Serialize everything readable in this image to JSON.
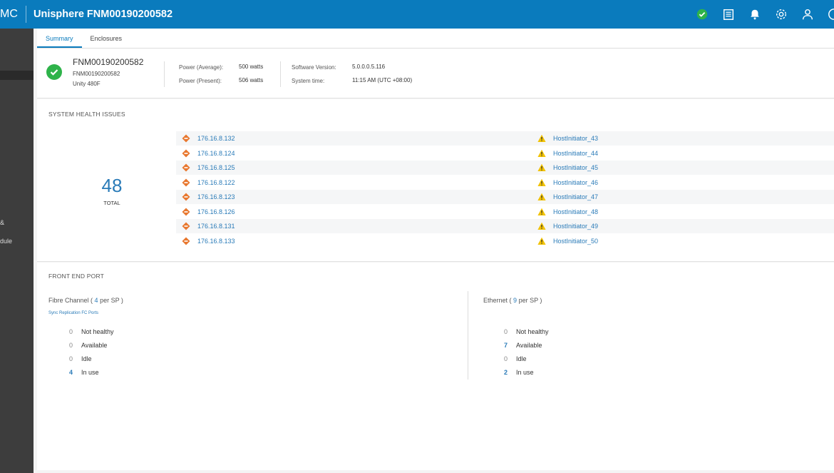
{
  "header": {
    "brand_fragment": "MC",
    "title": "Unisphere FNM00190200582",
    "icons": [
      "status-ok-icon",
      "jobs-icon",
      "alerts-bell-icon",
      "settings-gear-icon",
      "user-icon",
      "help-icon"
    ],
    "accent": "#0a7bbd"
  },
  "sidebar": {
    "fragments": [
      "&",
      "dule"
    ]
  },
  "tabs": [
    {
      "label": "Summary",
      "active": true
    },
    {
      "label": "Enclosures",
      "active": false
    }
  ],
  "system": {
    "name": "FNM00190200582",
    "serial": "FNM00190200582",
    "model": "Unity 480F",
    "power_avg_label": "Power (Average):",
    "power_avg_value": "500 watts",
    "power_present_label": "Power (Present):",
    "power_present_value": "506 watts",
    "software_label": "Software Version:",
    "software_value": "5.0.0.0.5.116",
    "time_label": "System time:",
    "time_value": "11:15 AM (UTC +08:00)"
  },
  "health": {
    "title": "SYSTEM HEALTH ISSUES",
    "total": "48",
    "total_label": "TOTAL",
    "left_issues": [
      "176.16.8.132",
      "176.16.8.124",
      "176.16.8.125",
      "176.16.8.122",
      "176.16.8.123",
      "176.16.8.126",
      "176.16.8.131",
      "176.16.8.133"
    ],
    "right_issues": [
      "HostInitiator_43",
      "HostInitiator_44",
      "HostInitiator_45",
      "HostInitiator_46",
      "HostInitiator_47",
      "HostInitiator_48",
      "HostInitiator_49",
      "HostInitiator_50"
    ],
    "colors": {
      "error": "#e8772e",
      "warning": "#f2c200"
    }
  },
  "front_end": {
    "title": "FRONT END PORT",
    "fc": {
      "label_prefix": "Fibre Channel (",
      "count": "4",
      "label_suffix": "per SP )",
      "link": "Sync Replication FC Ports",
      "stats": [
        {
          "n": "0",
          "label": "Not healthy"
        },
        {
          "n": "0",
          "label": "Available"
        },
        {
          "n": "0",
          "label": "Idle"
        },
        {
          "n": "4",
          "label": "In use"
        }
      ]
    },
    "eth": {
      "label_prefix": "Ethernet (",
      "count": "9",
      "label_suffix": "per SP )",
      "stats": [
        {
          "n": "0",
          "label": "Not healthy"
        },
        {
          "n": "7",
          "label": "Available"
        },
        {
          "n": "0",
          "label": "Idle"
        },
        {
          "n": "2",
          "label": "In use"
        }
      ]
    }
  }
}
